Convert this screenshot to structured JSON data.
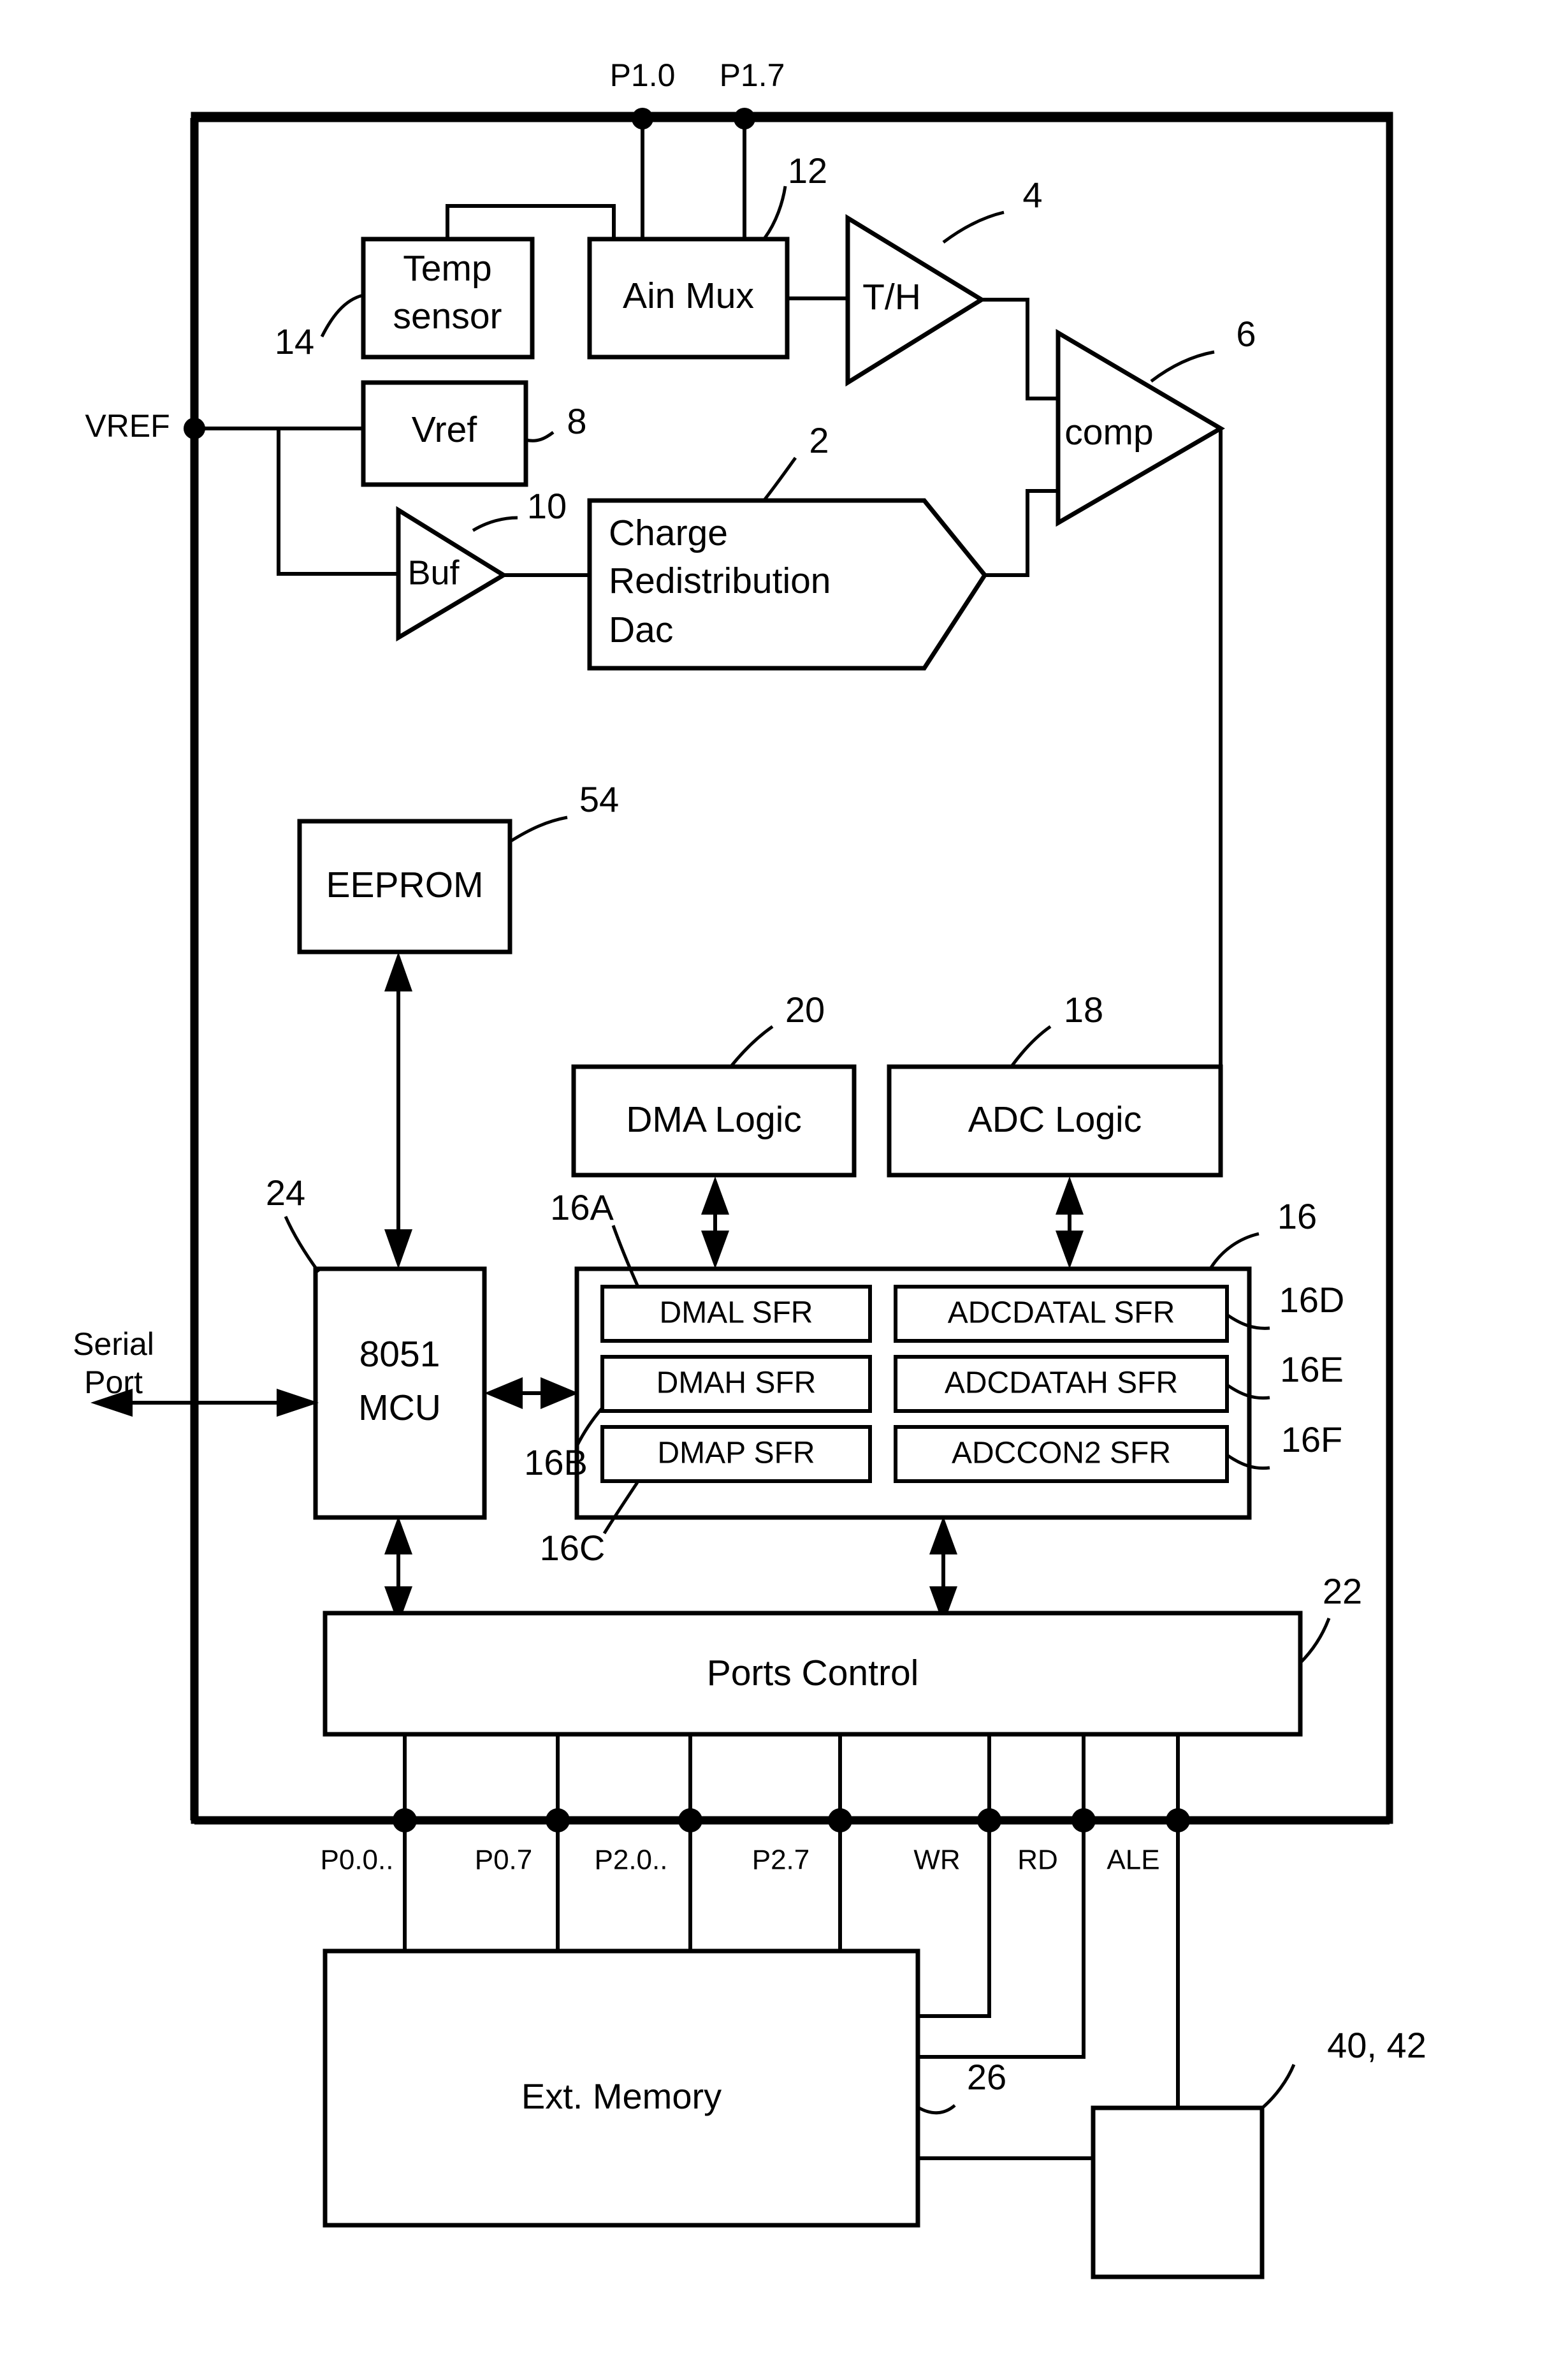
{
  "figure": {
    "type": "patent-block-diagram",
    "title": "ADC / 8051 MCU system block diagram"
  },
  "pins": {
    "p1_0": "P1.0",
    "p1_7": "P1.7",
    "vref": "VREF",
    "serial_port": "Serial\nPort",
    "serial_port_line1": "Serial",
    "serial_port_line2": "Port"
  },
  "blocks": {
    "temp_sensor_line1": "Temp",
    "temp_sensor_line2": "sensor",
    "ain_mux": "Ain Mux",
    "th": "T/H",
    "comp": "comp",
    "vref_block": "Vref",
    "buf": "Buf",
    "dac_line1": "Charge",
    "dac_line2": "Redistribution",
    "dac_line3": "Dac",
    "eeprom": "EEPROM",
    "dma_logic": "DMA Logic",
    "adc_logic": "ADC Logic",
    "mcu_line1": "8051",
    "mcu_line2": "MCU",
    "ports_control": "Ports Control",
    "ext_memory": "Ext. Memory"
  },
  "sfrs": {
    "left": [
      "DMAL SFR",
      "DMAH SFR",
      "DMAP SFR"
    ],
    "right": [
      "ADCDATAL SFR",
      "ADCDATAH SFR",
      "ADCCON2 SFR"
    ]
  },
  "port_labels": [
    "P0.0..",
    "P0.7",
    "P2.0..",
    "P2.7",
    "WR",
    "RD",
    "ALE"
  ],
  "reference_numerals": {
    "dac": "2",
    "th": "4",
    "comp": "6",
    "vref_block": "8",
    "buf": "10",
    "ain_mux": "12",
    "temp_sensor": "14",
    "sfr_group": "16",
    "dmal": "16A",
    "dmah": "16B",
    "dmap": "16C",
    "adcdatal": "16D",
    "adcdatah": "16E",
    "adccon2": "16F",
    "adc_logic": "18",
    "dma_logic": "20",
    "ports_control": "22",
    "mcu": "24",
    "bus_26": "26",
    "latch_40_42": "40, 42",
    "eeprom": "54"
  },
  "colors": {
    "ink": "#000000",
    "background": "#ffffff"
  }
}
